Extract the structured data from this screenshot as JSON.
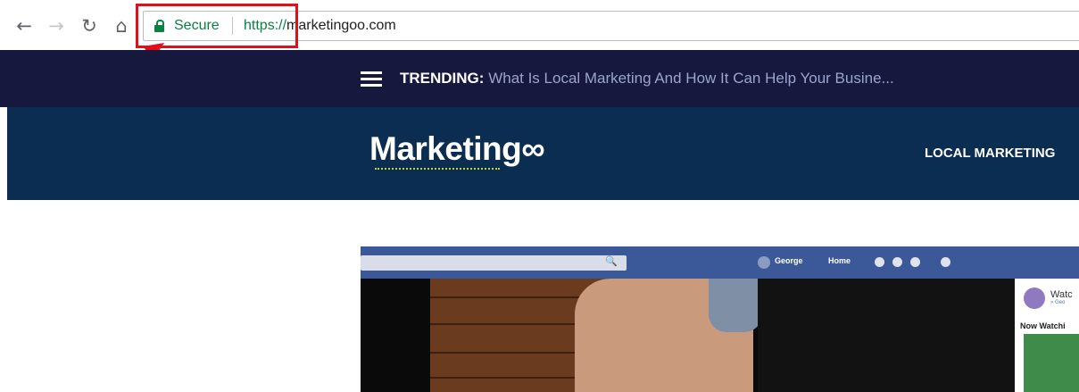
{
  "browser": {
    "back_icon": "arrow-left-icon",
    "forward_icon": "arrow-right-icon",
    "reload_icon": "reload-icon",
    "home_icon": "home-icon",
    "security_label": "Secure",
    "url_scheme": "https://",
    "url_host": "marketingoo.com"
  },
  "annotation": {
    "color": "#e0101a"
  },
  "site": {
    "trending_label": "TRENDING:",
    "trending_headline": "What Is Local Marketing And How It Can Help Your Busine...",
    "logo_text": "Marketing∞",
    "nav_link": "LOCAL MARKETING",
    "colors": {
      "trending_bg": "#16183e",
      "nav_bg": "#0b2d52",
      "logo_underline": "#c3d32f"
    }
  },
  "embedded": {
    "user": "George",
    "home": "Home",
    "side_title": "Watc",
    "side_sub": "» Geo",
    "now_watching": "Now Watchi"
  }
}
